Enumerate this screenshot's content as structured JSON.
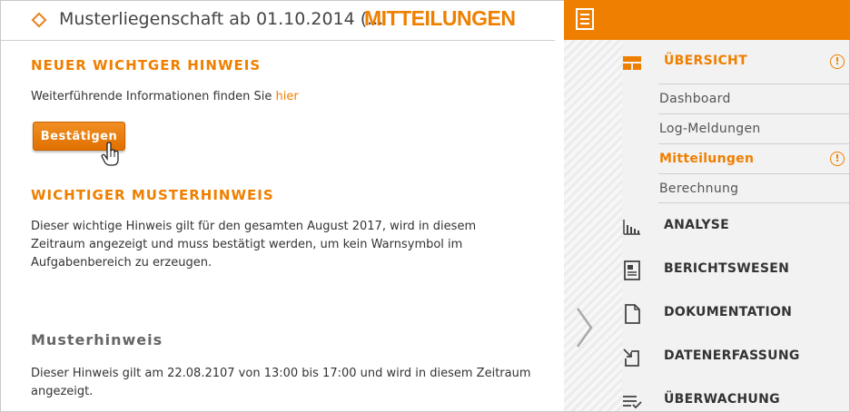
{
  "header": {
    "title": "Musterliegenschaft ab 01.10.2014 (...",
    "section": "MITTEILUNGEN"
  },
  "notices": [
    {
      "heading": "NEUER WICHTGER HINWEIS",
      "text": "Weiterführende Informationen finden Sie ",
      "link": "hier",
      "button": "Bestätigen"
    },
    {
      "heading": "WICHTIGER MUSTERHINWEIS",
      "text": "Dieser wichtige Hinweis gilt für den gesamten August 2017, wird in diesem Zeitraum angezeigt und muss bestätigt werden, um kein Warnsymbol im Aufgabenbereich zu erzeugen."
    },
    {
      "heading": "Musterhinweis",
      "text": "Dieser Hinweis gilt am 22.08.2107 von 13:00 bis 17:00 und wird in diesem Zeitraum angezeigt."
    }
  ],
  "nav": {
    "warning_symbol": "!",
    "overview": {
      "label": "ÜBERSICHT",
      "icon": "grid-icon"
    },
    "sub_items": [
      "Dashboard",
      "Log-Meldungen",
      "Mitteilungen",
      "Berechnung"
    ],
    "items": [
      {
        "label": "ANALYSE",
        "icon": "bar-chart-icon"
      },
      {
        "label": "BERICHTSWESEN",
        "icon": "report-icon"
      },
      {
        "label": "DOKUMENTATION",
        "icon": "document-icon"
      },
      {
        "label": "DATENERFASSUNG",
        "icon": "data-entry-icon"
      },
      {
        "label": "ÜBERWACHUNG",
        "icon": "monitoring-icon"
      }
    ]
  },
  "colors": {
    "accent": "#ef7f00",
    "nav_bg": "#f2f2f2"
  }
}
